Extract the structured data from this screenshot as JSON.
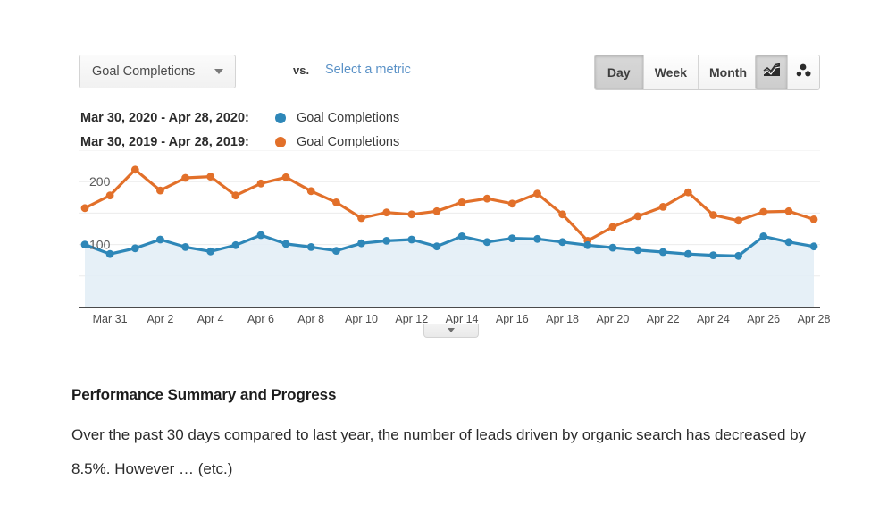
{
  "toolbar": {
    "metric_selected": "Goal Completions",
    "vs_label": "vs.",
    "compare_link": "Select a metric",
    "granularity": [
      {
        "label": "Day",
        "active": true
      },
      {
        "label": "Week",
        "active": false
      },
      {
        "label": "Month",
        "active": false
      }
    ],
    "chart_types": [
      {
        "name": "line-chart-icon",
        "active": true
      },
      {
        "name": "scatter-chart-icon",
        "active": false
      }
    ]
  },
  "legend": [
    {
      "range": "Mar 30, 2020 - Apr 28, 2020:",
      "metric": "Goal Completions",
      "color": "#2e87b8"
    },
    {
      "range": "Mar 30, 2019 - Apr 28, 2019:",
      "metric": "Goal Completions",
      "color": "#e2702a"
    }
  ],
  "summary": {
    "heading": "Performance Summary and Progress",
    "body": "Over the past 30 days compared to last year, the number of leads driven by organic search has decreased by 8.5%. However … (etc.)"
  },
  "chart_data": {
    "type": "line",
    "title": "",
    "xlabel": "",
    "ylabel": "",
    "ylim": [
      0,
      250
    ],
    "yticks": [
      100,
      200
    ],
    "ytick_labels": [
      "100",
      "200"
    ],
    "grid": true,
    "legend_position": "above-chart",
    "area_fill": {
      "series": "Mar 30, 2020 - Apr 28, 2020",
      "color": "#e3eef6"
    },
    "x": [
      "Mar 30",
      "Mar 31",
      "Apr 1",
      "Apr 2",
      "Apr 3",
      "Apr 4",
      "Apr 5",
      "Apr 6",
      "Apr 7",
      "Apr 8",
      "Apr 9",
      "Apr 10",
      "Apr 11",
      "Apr 12",
      "Apr 13",
      "Apr 14",
      "Apr 15",
      "Apr 16",
      "Apr 17",
      "Apr 18",
      "Apr 19",
      "Apr 20",
      "Apr 21",
      "Apr 22",
      "Apr 23",
      "Apr 24",
      "Apr 25",
      "Apr 26",
      "Apr 27",
      "Apr 28"
    ],
    "xtick_labels": [
      "Mar 31",
      "Apr 2",
      "Apr 4",
      "Apr 6",
      "Apr 8",
      "Apr 10",
      "Apr 12",
      "Apr 14",
      "Apr 16",
      "Apr 18",
      "Apr 20",
      "Apr 22",
      "Apr 24",
      "Apr 26",
      "Apr 28"
    ],
    "xtick_indices": [
      1,
      3,
      5,
      7,
      9,
      11,
      13,
      15,
      17,
      19,
      21,
      23,
      25,
      27,
      29
    ],
    "series": [
      {
        "name": "Mar 30, 2020 - Apr 28, 2020",
        "label": "Goal Completions",
        "color": "#2e87b8",
        "values": [
          100,
          85,
          94,
          108,
          96,
          89,
          99,
          115,
          101,
          96,
          90,
          102,
          106,
          108,
          97,
          113,
          104,
          110,
          109,
          104,
          99,
          95,
          91,
          88,
          85,
          83,
          82,
          113,
          104,
          97
        ]
      },
      {
        "name": "Mar 30, 2019 - Apr 28, 2019",
        "label": "Goal Completions",
        "color": "#e2702a",
        "values": [
          158,
          178,
          219,
          186,
          206,
          208,
          178,
          197,
          207,
          185,
          167,
          142,
          151,
          148,
          153,
          167,
          173,
          165,
          181,
          148,
          106,
          128,
          145,
          160,
          183,
          147,
          138,
          152,
          153,
          140
        ]
      }
    ]
  }
}
